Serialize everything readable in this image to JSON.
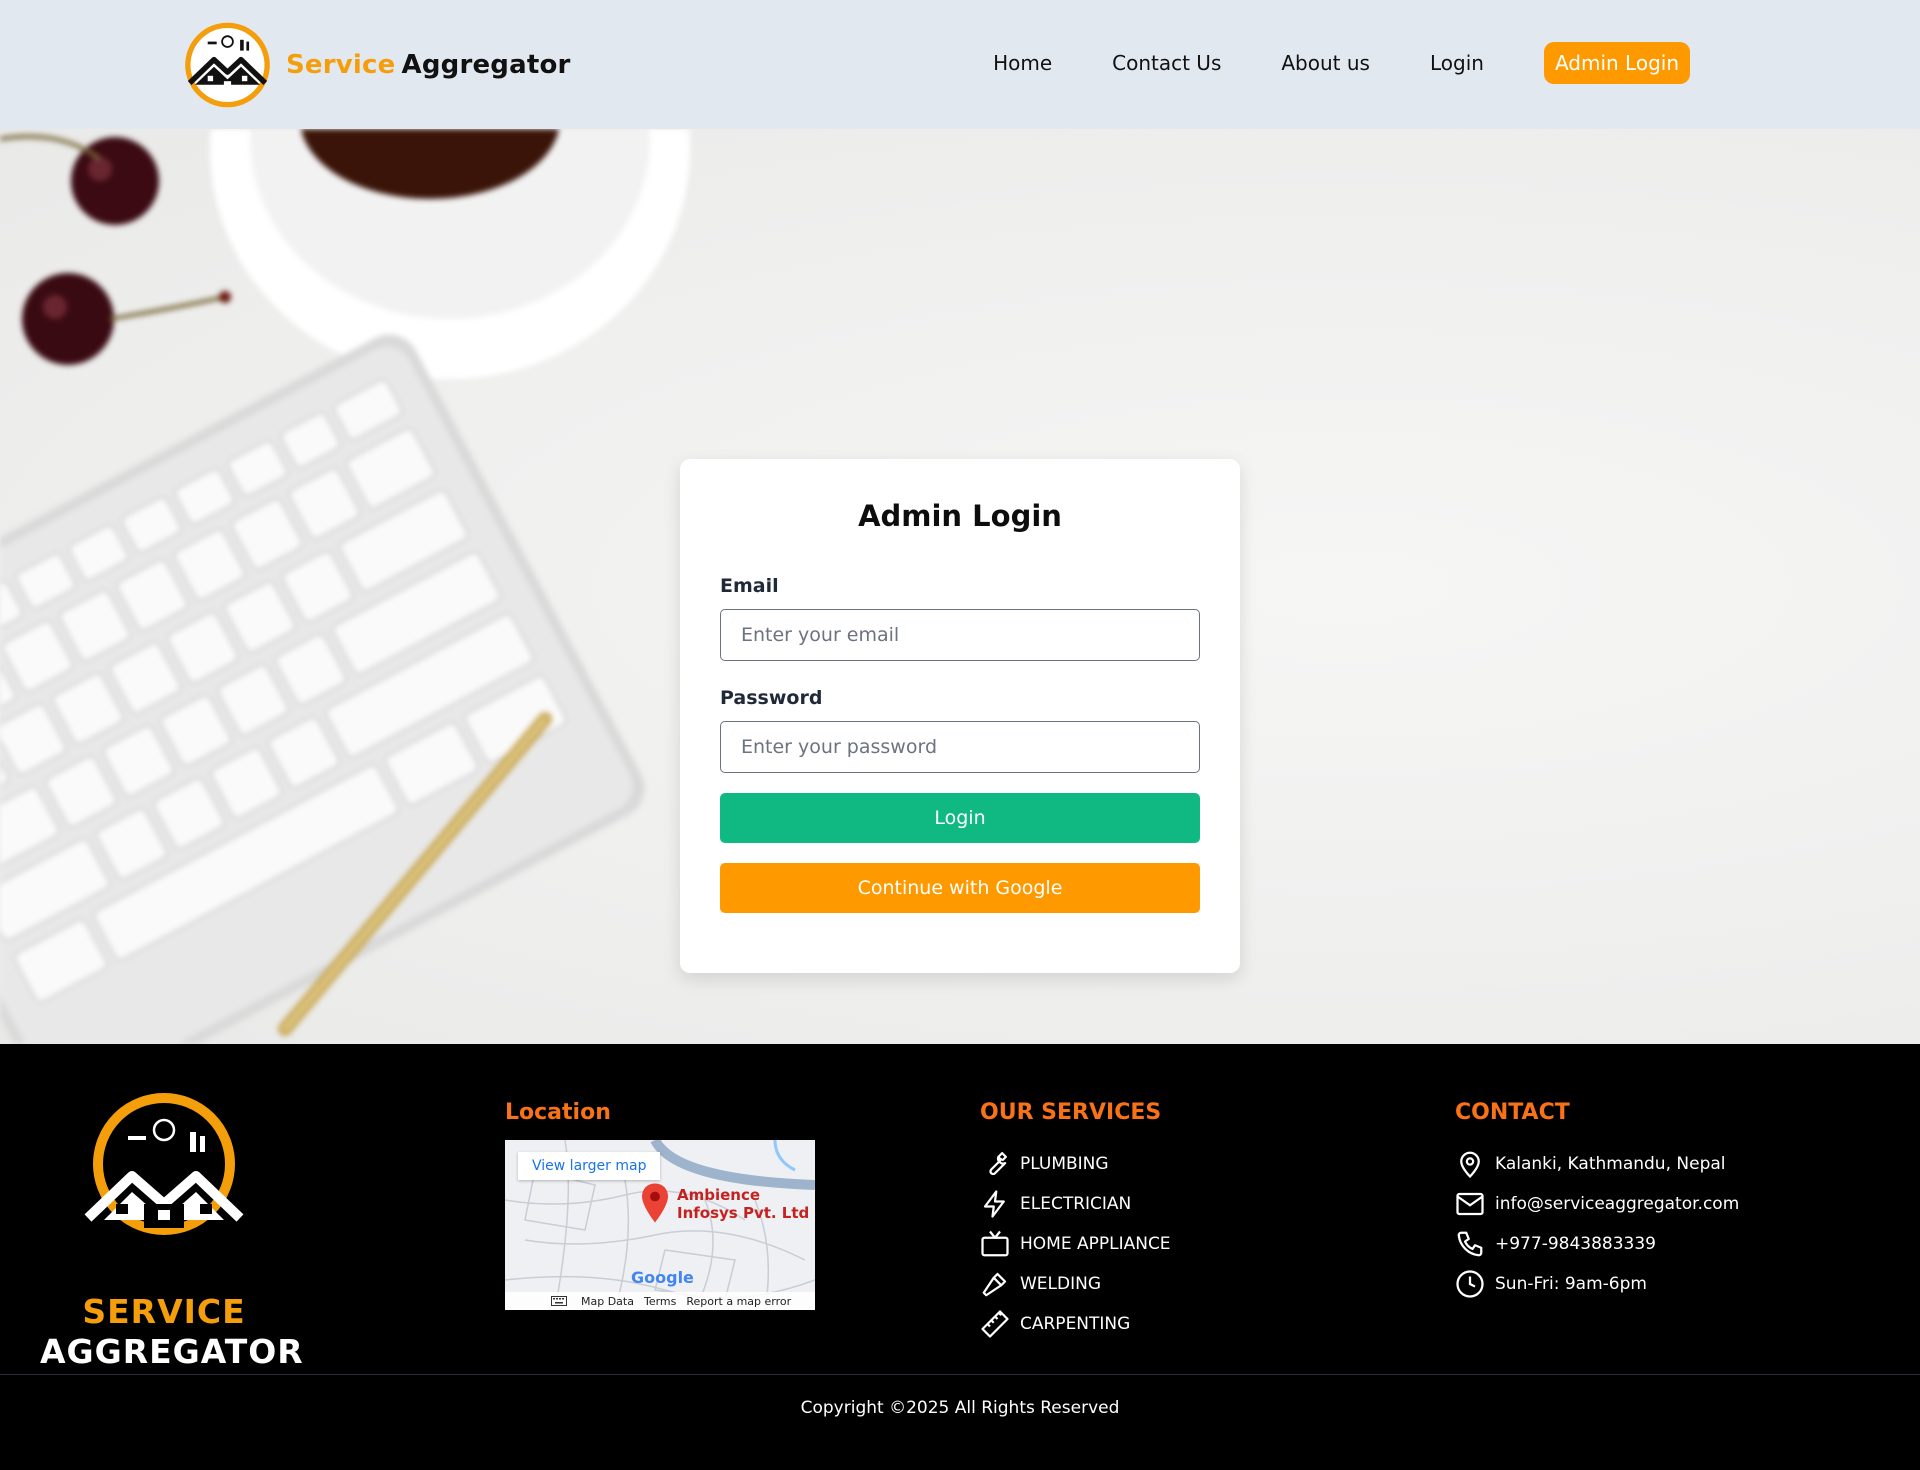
{
  "brand": {
    "word1": "Service",
    "word2": "Aggregator",
    "logo_icon": "service-aggregator-logo-icon"
  },
  "nav": {
    "home": "Home",
    "contact": "Contact Us",
    "about": "About us",
    "login": "Login",
    "admin_login": "Admin Login"
  },
  "login_card": {
    "title": "Admin Login",
    "email_label": "Email",
    "email_placeholder": "Enter your email",
    "password_label": "Password",
    "password_placeholder": "Enter your password",
    "login_button": "Login",
    "google_button": "Continue with Google"
  },
  "footer": {
    "logo_line1": "SERVICE",
    "logo_line2": "AGGREGATOR",
    "location_title": "Location",
    "map": {
      "view_larger": "View larger map",
      "place_line1": "Ambience",
      "place_line2": "Infosys Pvt. Ltd",
      "google": "Google",
      "map_data": "Map Data",
      "terms": "Terms",
      "report": "Report a map error"
    },
    "services_title": "OUR SERVICES",
    "services": [
      {
        "label": "PLUMBING",
        "icon": "wrench-icon"
      },
      {
        "label": "ELECTRICIAN",
        "icon": "lightning-icon"
      },
      {
        "label": "HOME APPLIANCE",
        "icon": "tv-icon"
      },
      {
        "label": "WELDING",
        "icon": "hammer-icon"
      },
      {
        "label": "CARPENTING",
        "icon": "ruler-icon"
      }
    ],
    "contact_title": "CONTACT",
    "contact": [
      {
        "label": "Kalanki, Kathmandu, Nepal",
        "icon": "location-pin-icon"
      },
      {
        "label": "info@serviceaggregator.com",
        "icon": "mail-icon"
      },
      {
        "label": "+977-9843883339",
        "icon": "phone-icon"
      },
      {
        "label": "Sun-Fri: 9am-6pm",
        "icon": "clock-icon"
      }
    ],
    "copyright": "Copyright ©2025 All Rights Reserved"
  },
  "colors": {
    "accent": "#ff9900",
    "login_green": "#10b981",
    "nav_bg": "#e2e8f0",
    "footer_title": "#f97316"
  }
}
